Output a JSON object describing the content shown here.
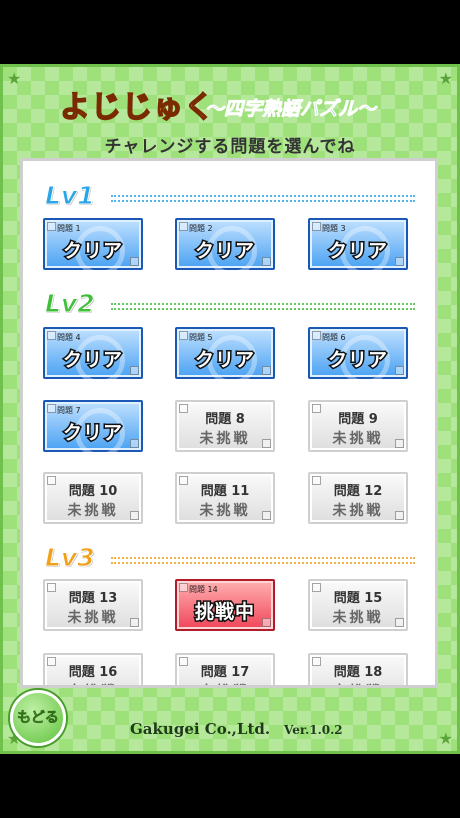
{
  "title": {
    "main": "よじじゅく",
    "sub": "〜四字熟語パズル〜"
  },
  "subtitle": "チャレンジする問題を選んでね",
  "levels": [
    {
      "label": "Lv1",
      "color": "#2aa6e8"
    },
    {
      "label": "Lv2",
      "color": "#3fbf3a"
    },
    {
      "label": "Lv3",
      "color": "#f0a01a"
    }
  ],
  "puzzles": [
    {
      "num": "問題 1",
      "status": "クリア",
      "state": "clear"
    },
    {
      "num": "問題 2",
      "status": "クリア",
      "state": "clear"
    },
    {
      "num": "問題 3",
      "status": "クリア",
      "state": "clear"
    },
    {
      "num": "問題 4",
      "status": "クリア",
      "state": "clear"
    },
    {
      "num": "問題 5",
      "status": "クリア",
      "state": "clear"
    },
    {
      "num": "問題 6",
      "status": "クリア",
      "state": "clear"
    },
    {
      "num": "問題 7",
      "status": "クリア",
      "state": "clear"
    },
    {
      "num": "問題 8",
      "status": "未挑戦",
      "state": "locked"
    },
    {
      "num": "問題 9",
      "status": "未挑戦",
      "state": "locked"
    },
    {
      "num": "問題 10",
      "status": "未挑戦",
      "state": "locked"
    },
    {
      "num": "問題 11",
      "status": "未挑戦",
      "state": "locked"
    },
    {
      "num": "問題 12",
      "status": "未挑戦",
      "state": "locked"
    },
    {
      "num": "問題 13",
      "status": "未挑戦",
      "state": "locked"
    },
    {
      "num": "問題 14",
      "status": "挑戦中",
      "state": "active"
    },
    {
      "num": "問題 15",
      "status": "未挑戦",
      "state": "locked"
    },
    {
      "num": "問題 16",
      "status": "未挑戦",
      "state": "locked"
    },
    {
      "num": "問題 17",
      "status": "未挑戦",
      "state": "locked"
    },
    {
      "num": "問題 18",
      "status": "未挑戦",
      "state": "locked"
    }
  ],
  "back_label": "もどる",
  "footer": {
    "company": "Gakugei Co.,Ltd.",
    "version": "Ver.1.0.2"
  }
}
